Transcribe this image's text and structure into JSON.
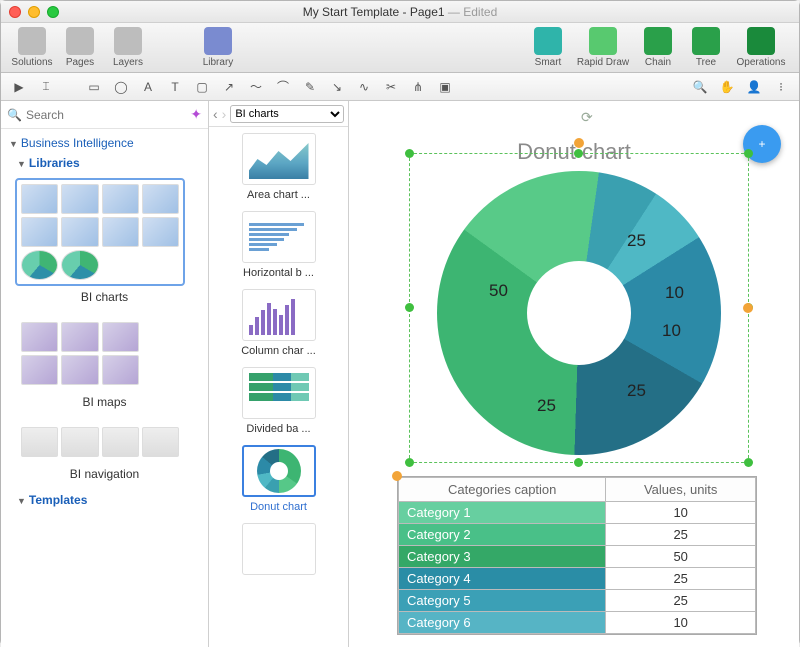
{
  "window": {
    "title": "My Start Template - Page1",
    "edited": " — Edited"
  },
  "mainToolbar": {
    "left": [
      {
        "label": "Solutions"
      },
      {
        "label": "Pages"
      },
      {
        "label": "Layers"
      }
    ],
    "library": {
      "label": "Library"
    },
    "right": [
      {
        "label": "Smart"
      },
      {
        "label": "Rapid Draw"
      },
      {
        "label": "Chain"
      },
      {
        "label": "Tree"
      },
      {
        "label": "Operations"
      }
    ]
  },
  "search": {
    "placeholder": "Search"
  },
  "sidebar": {
    "section": "Business Intelligence",
    "libraries_h": "Libraries",
    "templates_h": "Templates",
    "libs": [
      {
        "label": "BI charts"
      },
      {
        "label": "BI maps"
      },
      {
        "label": "BI navigation"
      }
    ]
  },
  "libCombo": {
    "selected": "BI charts"
  },
  "libItems": [
    {
      "label": "Area chart  ..."
    },
    {
      "label": "Horizontal b ..."
    },
    {
      "label": "Column char ..."
    },
    {
      "label": "Divided ba ..."
    },
    {
      "label": "Donut chart"
    }
  ],
  "chartTitle": "Donut chart",
  "chart_data": {
    "type": "pie",
    "title": "Donut chart",
    "categories": [
      "Category 1",
      "Category 2",
      "Category 3",
      "Category 4",
      "Category 5",
      "Category 6"
    ],
    "values": [
      10,
      25,
      50,
      25,
      25,
      10
    ],
    "colors": [
      "#67cfa0",
      "#49c088",
      "#34a867",
      "#2a8da6",
      "#3ba0b6",
      "#56b4c5"
    ],
    "donut_labels": {
      "50": "50",
      "25a": "25",
      "10a": "10",
      "10b": "10",
      "25b": "25",
      "25c": "25"
    },
    "table_headers": {
      "cat": "Categories caption",
      "val": "Values, units"
    }
  },
  "fab": "+"
}
